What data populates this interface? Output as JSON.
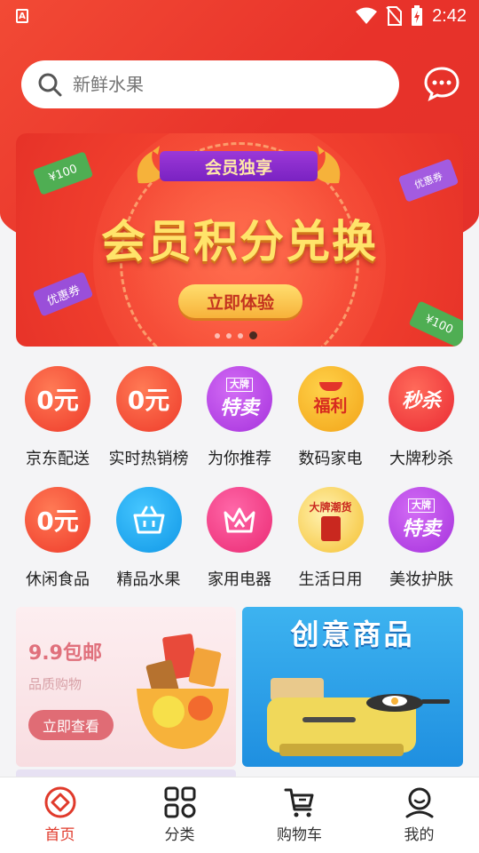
{
  "status_bar": {
    "time": "2:42"
  },
  "search": {
    "placeholder": "新鲜水果"
  },
  "banner": {
    "ribbon": "会员独享",
    "title": "会员积分兑换",
    "button": "立即体验",
    "coupons": [
      "¥100",
      "优惠券",
      "优惠券",
      "¥100"
    ],
    "slide_count": 4,
    "active_slide": 4
  },
  "categories": [
    [
      {
        "label": "京东配送",
        "badge": "0元",
        "icon": "zero-yuan-icon",
        "color": "#f04a35"
      },
      {
        "label": "实时热销榜",
        "badge": "0元",
        "icon": "zero-yuan-icon",
        "color": "#f04a35"
      },
      {
        "label": "为你推荐",
        "badge": "特卖",
        "sub": "大牌",
        "icon": "brand-sale-icon",
        "color": "#b53ee3"
      },
      {
        "label": "数码家电",
        "badge": "福利",
        "icon": "welfare-icon",
        "color": "#f5b21c"
      },
      {
        "label": "大牌秒杀",
        "badge": "秒杀",
        "icon": "flash-sale-icon",
        "color": "#f13b3b"
      }
    ],
    [
      {
        "label": "休闲食品",
        "badge": "0元",
        "icon": "zero-yuan-icon",
        "color": "#f04a35"
      },
      {
        "label": "精品水果",
        "badge": "",
        "icon": "basket-icon",
        "color": "#1ca6ee"
      },
      {
        "label": "家用电器",
        "badge": "",
        "icon": "crown-icon",
        "color": "#f23d8a"
      },
      {
        "label": "生活日用",
        "badge": "大牌潮货",
        "icon": "trend-goods-icon",
        "color": "#f5c030"
      },
      {
        "label": "美妆护肤",
        "badge": "特卖",
        "sub": "大牌",
        "icon": "brand-sale-icon",
        "color": "#b53ee3"
      }
    ]
  ],
  "promos": {
    "left": {
      "title": "9.9包邮",
      "subtitle": "品质购物",
      "button": "立即查看"
    },
    "right": {
      "title": "创意商品"
    }
  },
  "bottom_nav": [
    {
      "label": "首页",
      "icon": "home-icon",
      "active": true
    },
    {
      "label": "分类",
      "icon": "grid-icon",
      "active": false
    },
    {
      "label": "购物车",
      "icon": "cart-icon",
      "active": false
    },
    {
      "label": "我的",
      "icon": "profile-icon",
      "active": false
    }
  ],
  "colors": {
    "brand_red": "#e8322a",
    "nav_active": "#e03a2b"
  }
}
